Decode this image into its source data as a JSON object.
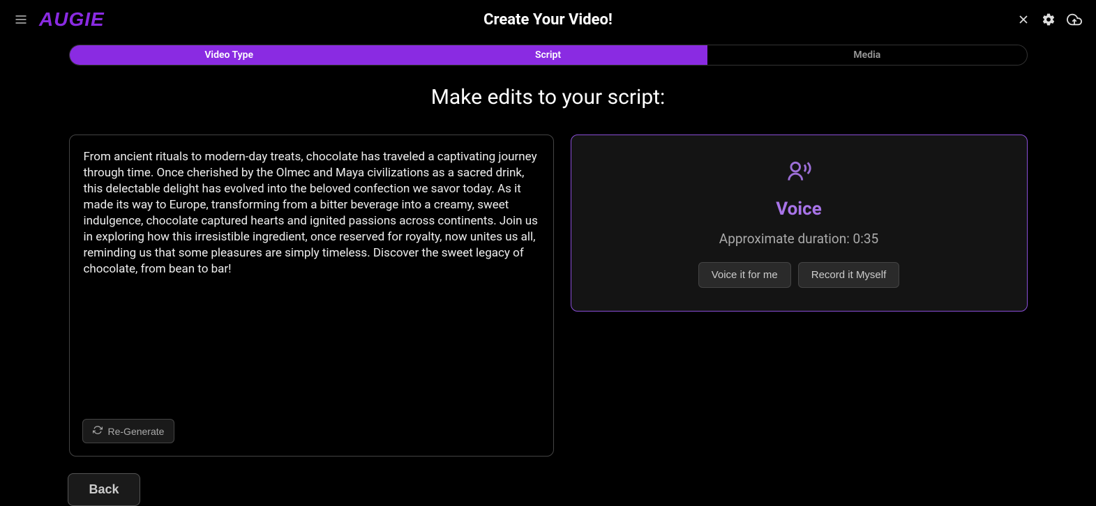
{
  "header": {
    "title": "Create Your Video!",
    "logo": "AUGIE"
  },
  "tabs": {
    "video_type": "Video Type",
    "script": "Script",
    "media": "Media"
  },
  "section_title": "Make edits to your script:",
  "script": {
    "text": "From ancient rituals to modern-day treats, chocolate has traveled a captivating journey through time. Once cherished by the Olmec and Maya civilizations as a sacred drink, this delectable delight has evolved into the beloved confection we savor today. As it made its way to Europe, transforming from a bitter beverage into a creamy, sweet indulgence, chocolate captured hearts and ignited passions across continents. Join us in exploring how this irresistible ingredient, once reserved for royalty, now unites us all, reminding us that some pleasures are simply timeless. Discover the sweet legacy of chocolate, from bean to bar!",
    "regenerate_label": "Re-Generate"
  },
  "voice": {
    "title": "Voice",
    "duration_label": "Approximate duration: 0:35",
    "voice_it_label": "Voice it for me",
    "record_label": "Record it Myself"
  },
  "back_label": "Back"
}
